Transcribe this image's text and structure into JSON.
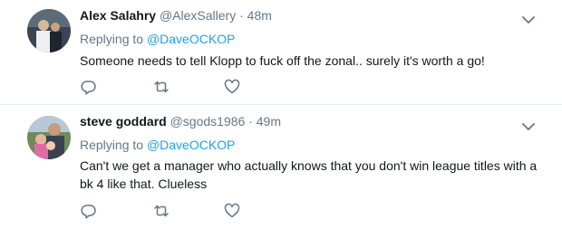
{
  "tweets": [
    {
      "name": "Alex Salahry",
      "handle": "@AlexSallery",
      "separator": "·",
      "time": "48m",
      "replying_prefix": "Replying to",
      "replying_to": "@DaveOCKOP",
      "text": "Someone needs to tell Klopp to fuck off the zonal.. surely it's worth a go!",
      "icons": {
        "avatar": "avatar-photo",
        "menu": "chevron-down-icon",
        "reply": "reply-icon",
        "retweet": "retweet-icon",
        "like": "heart-icon"
      }
    },
    {
      "name": "steve goddard",
      "handle": "@sgods1986",
      "separator": "·",
      "time": "49m",
      "replying_prefix": "Replying to",
      "replying_to": "@DaveOCKOP",
      "text": "Can't we get a manager who actually knows that you don't win league titles with a bk 4 like that. Clueless",
      "icons": {
        "avatar": "avatar-photo",
        "menu": "chevron-down-icon",
        "reply": "reply-icon",
        "retweet": "retweet-icon",
        "like": "heart-icon"
      }
    }
  ],
  "colors": {
    "text": "#14171a",
    "secondary": "#657786",
    "link": "#1da1f2",
    "divider": "#e6ecf0",
    "icon": "#657786"
  }
}
